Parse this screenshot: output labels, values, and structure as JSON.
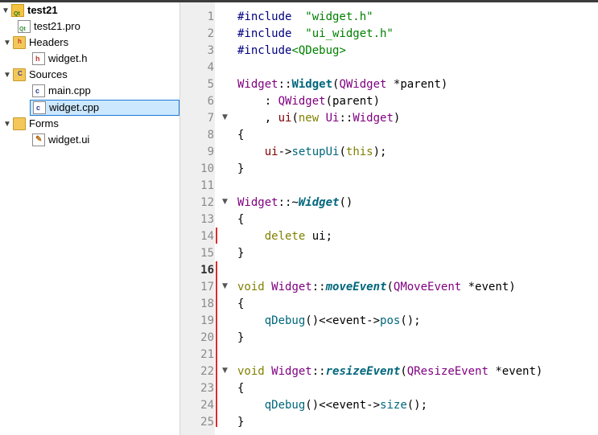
{
  "tree": {
    "project": "test21",
    "pro_file": "test21.pro",
    "headers": "Headers",
    "widget_h": "widget.h",
    "sources": "Sources",
    "main_cpp": "main.cpp",
    "widget_cpp": "widget.cpp",
    "forms": "Forms",
    "widget_ui": "widget.ui"
  },
  "editor": {
    "current_line": 16,
    "line_numbers": [
      "1",
      "2",
      "3",
      "4",
      "5",
      "6",
      "7",
      "8",
      "9",
      "10",
      "11",
      "12",
      "13",
      "14",
      "15",
      "16",
      "17",
      "18",
      "19",
      "20",
      "21",
      "22",
      "23",
      "24",
      "25"
    ],
    "lines": [
      [
        "#include ",
        " \"widget.h\""
      ],
      [
        "#include ",
        " \"ui_widget.h\""
      ],
      [
        "#include",
        "<QDebug>"
      ],
      [],
      [
        "Widget",
        "::",
        "Widget",
        "(",
        "QWidget",
        " *",
        "parent",
        ")"
      ],
      [
        "    : ",
        "QWidget",
        "(parent)"
      ],
      [
        "    , ",
        "ui",
        "(",
        "new",
        " ",
        "Ui",
        "::",
        "Widget",
        ")"
      ],
      [
        "{"
      ],
      [
        "    ",
        "ui",
        "->",
        "setupUi",
        "(",
        "this",
        ");"
      ],
      [
        "}"
      ],
      [],
      [
        "Widget",
        "::~",
        "Widget",
        "()"
      ],
      [
        "{"
      ],
      [
        "    ",
        "delete",
        " ",
        "ui",
        ";"
      ],
      [
        "}"
      ],
      [],
      [
        "void",
        " ",
        "Widget",
        "::",
        "moveEvent",
        "(",
        "QMoveEvent",
        " *",
        "event",
        ")"
      ],
      [
        "{"
      ],
      [
        "    ",
        "qDebug",
        "()<<",
        "event",
        "->",
        "pos",
        "();"
      ],
      [
        "}"
      ],
      [],
      [
        "void",
        " ",
        "Widget",
        "::",
        "resizeEvent",
        "(",
        "QResizeEvent",
        " *",
        "event",
        ")"
      ],
      [
        "{"
      ],
      [
        "    ",
        "qDebug",
        "()<<",
        "event",
        "->",
        "size",
        "();"
      ],
      [
        "}"
      ]
    ]
  },
  "colors": {
    "keyword": "#808000",
    "preprocessor": "#000080",
    "string": "#008000",
    "type": "#800080",
    "function": "#00677c",
    "change_marker": "#e0282a",
    "selection": "#cce8ff"
  }
}
